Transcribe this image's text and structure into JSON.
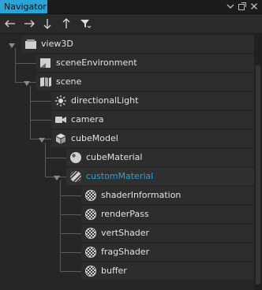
{
  "panel": {
    "tab_label": "Navigator"
  },
  "toolbar": {
    "back_icon": "arrow-left-icon",
    "forward_icon": "arrow-right-icon",
    "move_down_icon": "arrow-down-icon",
    "move_up_icon": "arrow-up-icon",
    "filter_icon": "filter-icon"
  },
  "colors": {
    "accent": "#2aa3d9",
    "background": "#262626",
    "row": "#2d2d2d"
  },
  "tree": {
    "nodes": [
      {
        "label": "view3D",
        "icon": "view3d-icon",
        "depth": 0,
        "expanded": true
      },
      {
        "label": "sceneEnvironment",
        "icon": "scene-environment-icon",
        "depth": 1
      },
      {
        "label": "scene",
        "icon": "scene-icon",
        "depth": 1,
        "expanded": true
      },
      {
        "label": "directionalLight",
        "icon": "light-icon",
        "depth": 2
      },
      {
        "label": "camera",
        "icon": "camera-icon",
        "depth": 2
      },
      {
        "label": "cubeModel",
        "icon": "model-icon",
        "depth": 2,
        "expanded": true
      },
      {
        "label": "cubeMaterial",
        "icon": "material-icon",
        "depth": 3
      },
      {
        "label": "customMaterial",
        "icon": "custom-material-icon",
        "depth": 3,
        "expanded": true,
        "selected": true
      },
      {
        "label": "shaderInformation",
        "icon": "shader-icon",
        "depth": 4
      },
      {
        "label": "renderPass",
        "icon": "shader-icon",
        "depth": 4
      },
      {
        "label": "vertShader",
        "icon": "shader-icon",
        "depth": 4
      },
      {
        "label": "fragShader",
        "icon": "shader-icon",
        "depth": 4
      },
      {
        "label": "buffer",
        "icon": "shader-icon",
        "depth": 4
      }
    ]
  }
}
